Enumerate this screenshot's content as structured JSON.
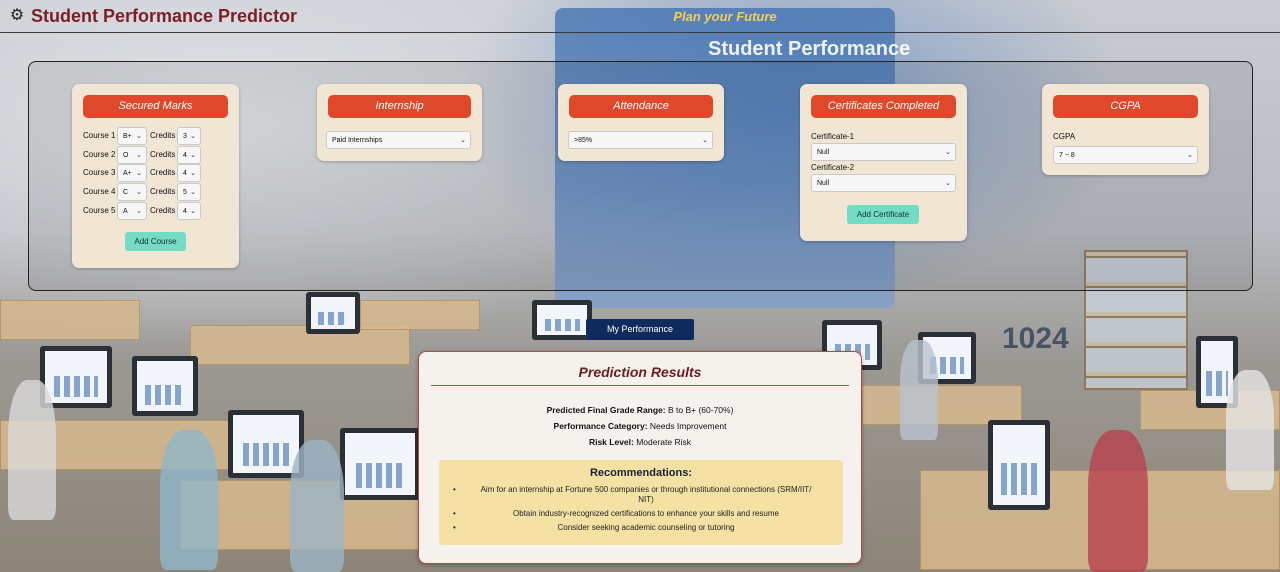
{
  "header": {
    "app_title": "Student Performance Predictor",
    "tagline": "Plan your Future",
    "icon": "gear-icon"
  },
  "background": {
    "board_text": "Student Performance",
    "wall_number": "1024"
  },
  "secured_marks": {
    "title": "Secured Marks",
    "course_label": "Course",
    "credits_label": "Credits",
    "courses": [
      {
        "name": "Course 1",
        "grade": "B+",
        "credits": "3"
      },
      {
        "name": "Course 2",
        "grade": "O",
        "credits": "4"
      },
      {
        "name": "Course 3",
        "grade": "A+",
        "credits": "4"
      },
      {
        "name": "Course 4",
        "grade": "C",
        "credits": "5"
      },
      {
        "name": "Course 5",
        "grade": "A",
        "credits": "4"
      }
    ],
    "add_button": "Add Course"
  },
  "internship": {
    "title": "Internship",
    "selected": "Paid Internships"
  },
  "attendance": {
    "title": "Attendance",
    "selected": ">85%"
  },
  "certificates": {
    "title": "Certificates Completed",
    "items": [
      {
        "label": "Certificate-1",
        "selected": "Null"
      },
      {
        "label": "Certificate-2",
        "selected": "Null"
      }
    ],
    "add_button": "Add Certificate"
  },
  "cgpa": {
    "title": "CGPA",
    "label": "CGPA",
    "selected": "7 ~ 8"
  },
  "my_performance_button": "My Performance",
  "results": {
    "title": "Prediction Results",
    "grade_range_label": "Predicted Final Grade Range:",
    "grade_range_value": "B to B+ (60-70%)",
    "category_label": "Performance Category:",
    "category_value": "Needs Improvement",
    "risk_label": "Risk Level:",
    "risk_value": "Moderate Risk",
    "recommendations_title": "Recommendations:",
    "recommendations": [
      "Aim for an internship at Fortune 500 companies or through institutional connections (SRM/IIT/ NIT)",
      "Obtain industry-recognized certifications to enhance your skills and resume",
      "Consider seeking academic counseling or tutoring"
    ]
  },
  "colors": {
    "card_header": "#e0482b",
    "card_bg": "#f1e6d3",
    "title": "#7b1f26",
    "tagline": "#f2cf5a",
    "teal_button": "#74dbc4",
    "navy_button": "#0f2a5c",
    "reco_bg": "#f4e1a3"
  }
}
